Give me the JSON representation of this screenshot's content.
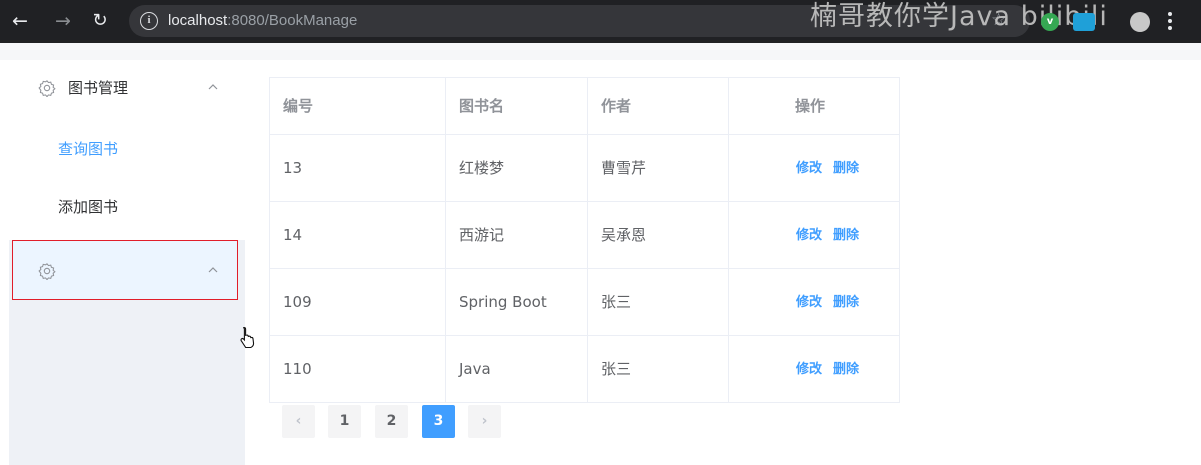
{
  "browser": {
    "url_host": "localhost",
    "url_rest": ":8080/BookManage",
    "watermark": "楠哥教你学Java bilibili"
  },
  "sidebar": {
    "menu1": {
      "title": "图书管理",
      "items": [
        {
          "label": "查询图书",
          "active": true
        },
        {
          "label": "添加图书",
          "active": false
        }
      ]
    },
    "menu2": {
      "title": ""
    }
  },
  "table": {
    "columns": [
      "编号",
      "图书名",
      "作者",
      "操作"
    ],
    "rows": [
      {
        "id": "13",
        "name": "红楼梦",
        "author": "曹雪芹"
      },
      {
        "id": "14",
        "name": "西游记",
        "author": "吴承恩"
      },
      {
        "id": "109",
        "name": "Spring Boot",
        "author": "张三"
      },
      {
        "id": "110",
        "name": "Java",
        "author": "张三"
      }
    ],
    "actions": {
      "edit": "修改",
      "delete": "删除"
    }
  },
  "pagination": {
    "prev": "‹",
    "pages": [
      "1",
      "2",
      "3"
    ],
    "current": "3",
    "next": "›"
  },
  "colors": {
    "primary": "#409eff",
    "selection_border": "#e11d2a",
    "sidebar_bg": "#eef1f6"
  },
  "icons": {
    "back": "arrow-left",
    "forward": "arrow-right",
    "reload": "reload",
    "site_info": "info",
    "bookmark": "star",
    "menu": "gear",
    "collapse": "chevron-up",
    "cursor": "hand-pointer"
  }
}
